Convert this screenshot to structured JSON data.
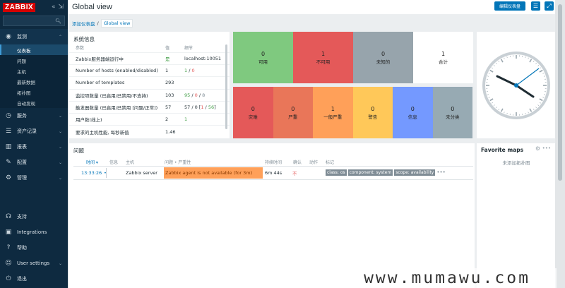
{
  "sidebar": {
    "logo": "ZABBIX",
    "search_placeholder": "",
    "sections": [
      {
        "label": "监测",
        "icon": "eye-icon"
      },
      {
        "label": "服务",
        "icon": "clock-icon"
      },
      {
        "label": "资产记录",
        "icon": "list-icon"
      },
      {
        "label": "报表",
        "icon": "chart-icon"
      },
      {
        "label": "配置",
        "icon": "wrench-icon"
      },
      {
        "label": "管理",
        "icon": "gear-icon"
      }
    ],
    "monitoring_items": [
      "仪表板",
      "问题",
      "主机",
      "最新数据",
      "拓扑图",
      "自动发现"
    ],
    "bottom": [
      {
        "label": "支持",
        "icon": "headset-icon"
      },
      {
        "label": "Integrations",
        "icon": "integrations-icon"
      },
      {
        "label": "帮助",
        "icon": "help-icon"
      },
      {
        "label": "User settings",
        "icon": "user-icon"
      },
      {
        "label": "退出",
        "icon": "logout-icon"
      }
    ]
  },
  "header": {
    "title": "Global view",
    "edit_button": "编辑仪表盘"
  },
  "breadcrumb": [
    "添加仪表盘",
    "Global view"
  ],
  "system_info": {
    "title": "系统信息",
    "columns": [
      "参数",
      "值",
      "细节"
    ],
    "rows": [
      {
        "param": "Zabbix服务器端运行中",
        "value": "是",
        "detail": "localhost:10051"
      },
      {
        "param": "Number of hosts (enabled/disabled)",
        "value": "1",
        "detail_a": "1",
        "detail_sep": " / ",
        "detail_b": "0"
      },
      {
        "param": "Number of templates",
        "value": "293",
        "detail": ""
      },
      {
        "param": "监控项数量 (已启用/已禁用/不支持)",
        "value": "103",
        "detail_a": "95",
        "detail_sep1": " / ",
        "detail_b": "0",
        "detail_sep2": " / ",
        "detail_c": "8"
      },
      {
        "param": "触发器数量 (已启用/已禁用 [问题/正常])",
        "value": "57",
        "detail_a": "57 / 0 [",
        "detail_b": "1",
        "detail_sep": " / ",
        "detail_c": "56",
        "detail_d": "]"
      },
      {
        "param": "用户数(线上)",
        "value": "2",
        "detail": "1"
      },
      {
        "param": "要求的主机性能, 每秒新值",
        "value": "1.46",
        "detail": ""
      }
    ]
  },
  "host_availability": [
    {
      "count": "0",
      "label": "可用",
      "color": "#7fc97f"
    },
    {
      "count": "1",
      "label": "不可用",
      "color": "#e45959"
    },
    {
      "count": "0",
      "label": "未知的",
      "color": "#97a4ac"
    },
    {
      "count": "1",
      "label": "合计",
      "color": "#ffffff"
    }
  ],
  "severity": [
    {
      "count": "0",
      "label": "灾难",
      "color": "#e45959"
    },
    {
      "count": "0",
      "label": "严重",
      "color": "#e97659"
    },
    {
      "count": "1",
      "label": "一般严重",
      "color": "#ffa059"
    },
    {
      "count": "0",
      "label": "警告",
      "color": "#ffc859"
    },
    {
      "count": "0",
      "label": "信息",
      "color": "#7499ff"
    },
    {
      "count": "0",
      "label": "未分类",
      "color": "#97aab3"
    }
  ],
  "problems": {
    "title": "问题",
    "columns": [
      "时间 ▾",
      "信息",
      "主机",
      "问题 • 严重性",
      "持续时间",
      "确认",
      "动作",
      "标记"
    ],
    "row": {
      "time": "13:33:26",
      "host": "Zabbix server",
      "problem": "Zabbix agent is not available (for 3m)",
      "duration": "6m 44s",
      "ack": "不",
      "tags": [
        "class: os",
        "component: system",
        "scope: availability"
      ],
      "more": "•••",
      "problem_color": "#ffa059"
    }
  },
  "favorite_maps": {
    "title": "Favorite maps",
    "empty": "未添加拓扑图"
  },
  "watermark": "www.mumawu.com"
}
